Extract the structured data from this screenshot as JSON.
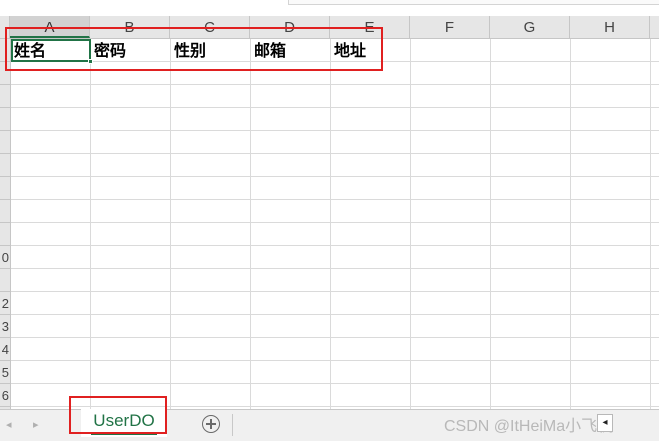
{
  "columns": [
    "A",
    "B",
    "C",
    "D",
    "E",
    "F",
    "G",
    "H"
  ],
  "rows": [
    "",
    "",
    "",
    "",
    "",
    "",
    "",
    "",
    "",
    "0",
    "",
    "2",
    "3",
    "4",
    "5",
    "6"
  ],
  "header_row": [
    "姓名",
    "密码",
    "性别",
    "邮箱",
    "地址"
  ],
  "sheet_tab": {
    "label": "UserDO"
  },
  "nav": {
    "prev": "◂",
    "next": "▸"
  },
  "scroll": {
    "left_arrow": "◂"
  },
  "watermark": "CSDN @ItHeiMa小飞机",
  "colors": {
    "accent": "#217346",
    "highlight": "#e02020"
  }
}
